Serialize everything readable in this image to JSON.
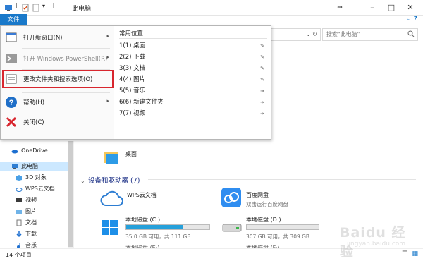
{
  "window": {
    "title": "此电脑",
    "min_icon": "minimize-icon",
    "max_icon": "maximize-icon",
    "close_icon": "close-icon",
    "expand_arrows": "⇔"
  },
  "ribbon": {
    "file_tab": "文件",
    "help": "?"
  },
  "search": {
    "placeholder": "搜索\"此电脑\""
  },
  "file_menu": {
    "left_items": [
      {
        "label": "打开新窗口(N)",
        "icon": "window-icon",
        "has_arrow": true,
        "disabled": false
      },
      {
        "label": "打开 Windows PowerShell(R)",
        "icon": "powershell-icon",
        "has_arrow": true,
        "disabled": true
      },
      {
        "label": "更改文件夹和搜索选项(O)",
        "icon": "options-icon",
        "has_arrow": false,
        "disabled": false,
        "highlighted": true
      },
      {
        "label": "帮助(H)",
        "icon": "help-icon",
        "has_arrow": true,
        "disabled": false
      },
      {
        "label": "关闭(C)",
        "icon": "close-x-icon",
        "has_arrow": false,
        "disabled": false
      }
    ],
    "frequent_title": "常用位置",
    "frequent_items": [
      {
        "label": "1(1) 桌面",
        "pinned": true
      },
      {
        "label": "2(2) 下载",
        "pinned": true
      },
      {
        "label": "3(3) 文档",
        "pinned": true
      },
      {
        "label": "4(4) 图片",
        "pinned": true
      },
      {
        "label": "5(5) 音乐",
        "pinned": false
      },
      {
        "label": "6(6) 新建文件夹",
        "pinned": false
      },
      {
        "label": "7(7) 视频",
        "pinned": false
      }
    ]
  },
  "nav": {
    "items": [
      {
        "label": "OneDrive",
        "icon": "cloud-icon",
        "selected": false
      },
      {
        "label": "此电脑",
        "icon": "computer-icon",
        "selected": true
      },
      {
        "label": "3D 对象",
        "icon": "3d-objects-icon",
        "selected": false
      },
      {
        "label": "WPS云文档",
        "icon": "wps-cloud-icon",
        "selected": false
      },
      {
        "label": "视频",
        "icon": "video-folder-icon",
        "selected": false
      },
      {
        "label": "图片",
        "icon": "picture-folder-icon",
        "selected": false
      },
      {
        "label": "文档",
        "icon": "document-folder-icon",
        "selected": false
      },
      {
        "label": "下载",
        "icon": "download-folder-icon",
        "selected": false
      },
      {
        "label": "音乐",
        "icon": "music-folder-icon",
        "selected": false
      }
    ]
  },
  "content": {
    "desktop_folder": "桌面",
    "section_title": "设备和驱动器 (7)",
    "devices": [
      {
        "name": "WPS云文档",
        "sub": "",
        "icon": "wps-cloud-drive-icon"
      },
      {
        "name": "百度网盘",
        "sub": "双击运行百度网盘",
        "icon": "baidu-netdisk-icon"
      }
    ],
    "drives": [
      {
        "name": "本地磁盘 (C:)",
        "sub": "35.0 GB 可用，共 111 GB",
        "used_fraction": 0.68,
        "icon": "windows-drive-icon"
      },
      {
        "name": "本地磁盘 (D:)",
        "sub": "307 GB 可用，共 309 GB",
        "used_fraction": 0.01,
        "icon": "hard-drive-icon"
      }
    ],
    "partial_row": {
      "left": "本地磁盘 (E:)",
      "right": "本地磁盘 (F:)"
    }
  },
  "status": {
    "count": "14 个项目"
  },
  "watermark": {
    "text": "Baidu 经验",
    "url": "jingyan.baidu.com"
  },
  "colors": {
    "accent": "#1979ca",
    "highlight": "#d8262e",
    "bar": "#26a0da",
    "selected": "#cce8ff"
  }
}
